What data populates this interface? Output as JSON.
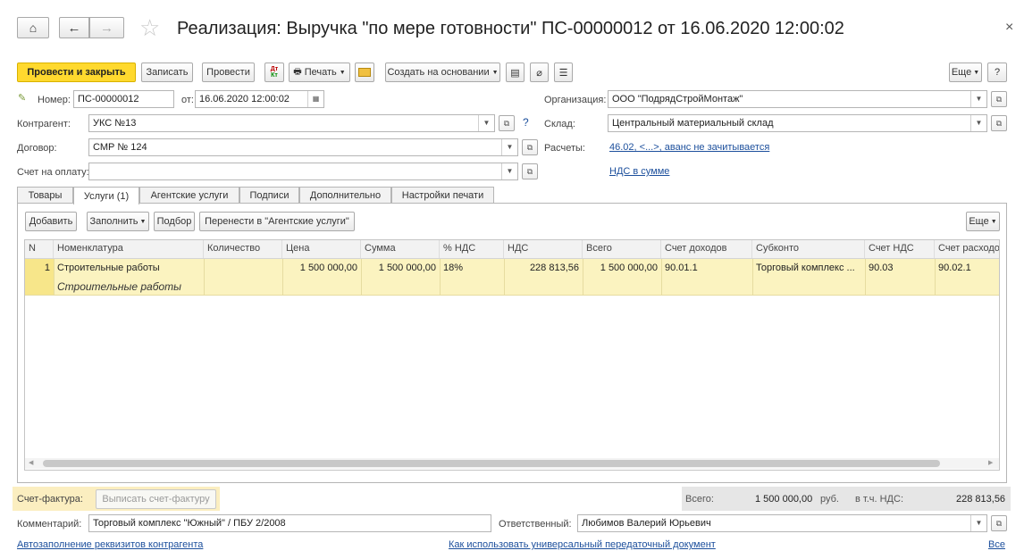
{
  "header": {
    "title": "Реализация: Выручка \"по мере готовности\" ПС-00000012 от 16.06.2020 12:00:02",
    "close_glyph": "×"
  },
  "toolbar": {
    "post_close": "Провести и закрыть",
    "save": "Записать",
    "post": "Провести",
    "dt_kt": "Дт\nКт",
    "print": "Печать",
    "create_based": "Создать на основании",
    "more": "Еще",
    "help": "?"
  },
  "form": {
    "number_label": "Номер:",
    "number_value": "ПС-00000012",
    "date_label": "от:",
    "date_value": "16.06.2020 12:00:02",
    "org_label": "Организация:",
    "org_value": "ООО \"ПодрядСтройМонтаж\"",
    "counterparty_label": "Контрагент:",
    "counterparty_value": "УКС №13",
    "warehouse_label": "Склад:",
    "warehouse_value": "Центральный материальный склад",
    "contract_label": "Договор:",
    "contract_value": "СМР № 124",
    "settlements_label": "Расчеты:",
    "settlements_link": "46.02, <...>, аванс не зачитывается",
    "invoice_label": "Счет на оплату:",
    "invoice_value": "",
    "vat_link": "НДС в сумме"
  },
  "tabs": [
    "Товары",
    "Услуги (1)",
    "Агентские услуги",
    "Подписи",
    "Дополнительно",
    "Настройки печати"
  ],
  "table_toolbar": {
    "add": "Добавить",
    "fill": "Заполнить",
    "select": "Подбор",
    "move": "Перенести в \"Агентские услуги\"",
    "more": "Еще"
  },
  "table": {
    "columns": [
      "N",
      "Номенклатура",
      "Количество",
      "Цена",
      "Сумма",
      "% НДС",
      "НДС",
      "Всего",
      "Счет доходов",
      "Субконто",
      "Счет НДС",
      "Счет расходов"
    ],
    "rows": [
      {
        "n": "1",
        "item": "Строительные работы",
        "item_desc": "Строительные работы",
        "qty": "",
        "price": "1 500 000,00",
        "sum": "1 500 000,00",
        "vat_rate": "18%",
        "vat": "228 813,56",
        "total": "1 500 000,00",
        "income_account": "90.01.1",
        "subconto": "Торговый комплекс ...",
        "vat_account": "90.03",
        "expense_account": "90.02.1"
      }
    ]
  },
  "footer": {
    "invoice_label": "Счет-фактура:",
    "invoice_button": "Выписать счет-фактуру",
    "total_label": "Всего:",
    "total_value": "1 500 000,00",
    "currency": "руб.",
    "vat_label": "в т.ч. НДС:",
    "vat_value": "228 813,56",
    "comment_label": "Комментарий:",
    "comment_value": "Торговый комплекс \"Южный\" / ПБУ 2/2008",
    "responsible_label": "Ответственный:",
    "responsible_value": "Любимов Валерий Юрьевич",
    "link_autofill": "Автозаполнение реквизитов контрагента",
    "link_upd": "Как использовать универсальный передаточный документ",
    "link_all": "Все"
  }
}
